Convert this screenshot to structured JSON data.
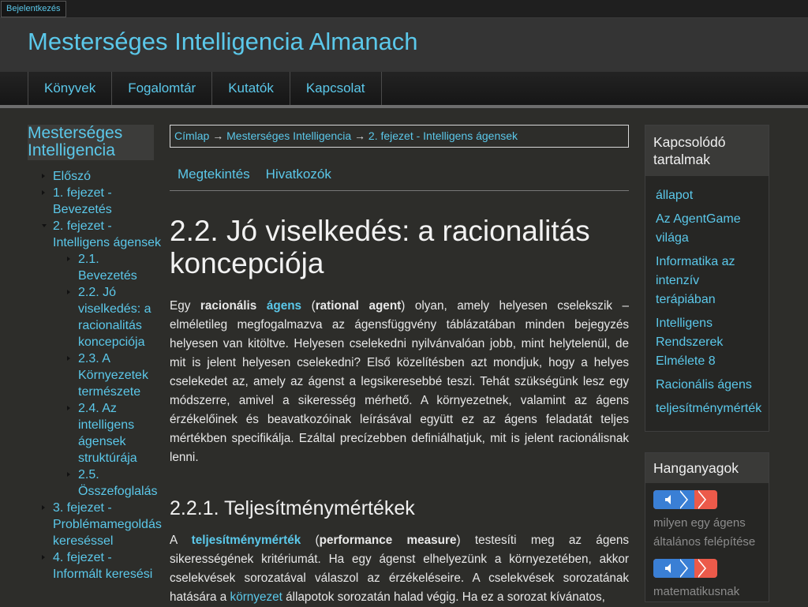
{
  "toolbar": {
    "login_label": "Bejelentkezés"
  },
  "header": {
    "site_title": "Mesterséges Intelligencia Almanach"
  },
  "nav": {
    "items": [
      "Könyvek",
      "Fogalomtár",
      "Kutatók",
      "Kapcsolat"
    ]
  },
  "left_sidebar": {
    "book_title": "Mesterséges Intelligencia",
    "toc": [
      {
        "label": "Előszó"
      },
      {
        "label": "1. fejezet - Bevezetés"
      },
      {
        "label": "2. fejezet - Intelligens ágensek"
      },
      {
        "label": "2.1. Bevezetés"
      },
      {
        "label": "2.2. Jó viselkedés: a racionalitás koncepciója"
      },
      {
        "label": "2.3. A Környezetek természete"
      },
      {
        "label": "2.4. Az intelligens ágensek struktúrája"
      },
      {
        "label": "2.5. Összefoglalás"
      },
      {
        "label": "3. fejezet - Problémamegoldás kereséssel"
      },
      {
        "label": "4. fejezet - Informált keresési"
      }
    ]
  },
  "breadcrumb": {
    "items": [
      "Címlap",
      "Mesterséges Intelligencia",
      "2. fejezet - Intelligens ágensek"
    ],
    "separator": "→"
  },
  "tabs": {
    "view": "Megtekintés",
    "references": "Hivatkozók"
  },
  "article": {
    "title": "2.2. Jó viselkedés: a racionalitás koncepciója",
    "p1": {
      "t1": "Egy ",
      "b1": "racionális",
      "l1": "ágens",
      "t2": " (",
      "b2": "rational agent",
      "t3": ") olyan, amely helyesen cselekszik – elméletileg megfogalmazva az ágensfüggvény táblázatában minden bejegyzés helyesen van kitöltve. Helyesen cselekedni nyilvánvalóan jobb, mint helytelenül, de mit is jelent helyesen cselekedni? Első közelítésben azt mondjuk, hogy a helyes cselekedet az, amely az ágenst a legsikeresebbé teszi. Tehát szükségünk lesz egy módszerre, amivel a sikeresség mérhető. A környezetnek, valamint az ágens érzékelőinek és beavatkozóinak leírásával együtt ez az ágens feladatát teljes mértékben specifikálja. Ezáltal precízebben definiálhatjuk, mit is jelent racionálisnak lenni."
    },
    "section_title": "2.2.1. Teljesítménymértékek",
    "p2": {
      "t1": "A ",
      "l1": "teljesítménymérték",
      "t2": " (",
      "b1": "performance measure",
      "t3": ") testesíti meg az ágens sikerességének kritériumát. Ha egy ágenst elhelyezünk a környezetében, akkor cselekvések sorozatával válaszol az érzékeléseire. A cselekvések sorozatának hatására a ",
      "l2": "környezet",
      "t4": " állapotok sorozatán halad végig. Ha ez a sorozat kívánatos,"
    }
  },
  "related": {
    "title": "Kapcsolódó tartalmak",
    "items": [
      "állapot",
      "Az AgentGame világa",
      "Informatika az intenzív terápiában",
      "Intelligens Rendszerek Elmélete 8",
      "Racionális ágens",
      "teljesítménymérték"
    ]
  },
  "audio": {
    "title": "Hanganyagok",
    "items": [
      "milyen egy ágens általános felépítése",
      "matematikusnak"
    ]
  },
  "colors": {
    "background": "#2d2d2a",
    "link": "#5bc8ea",
    "player_blue": "#3a7fd5",
    "player_red": "#ec5a4a"
  }
}
